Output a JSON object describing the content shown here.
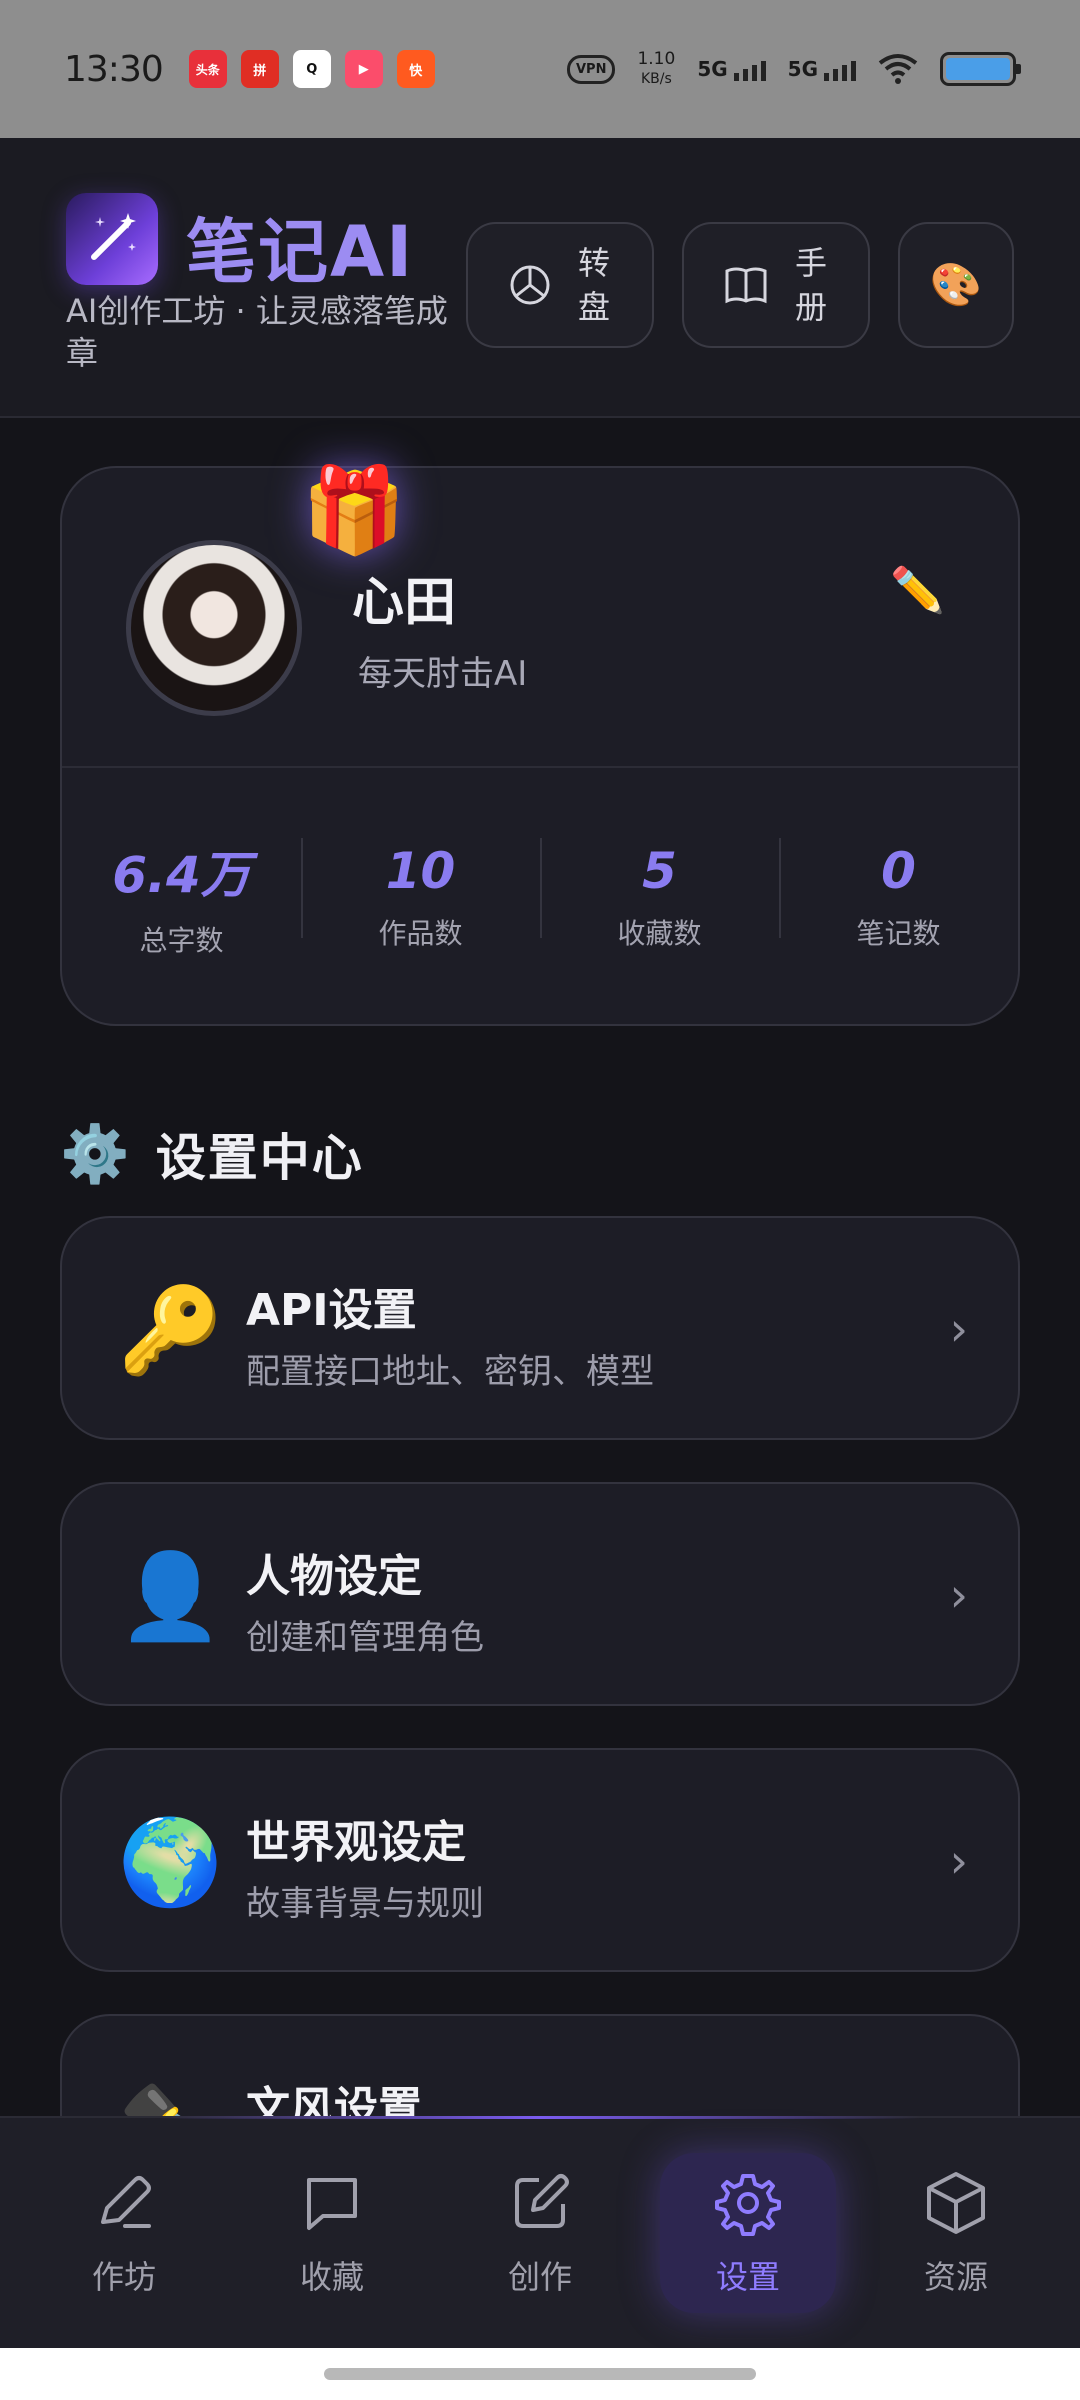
{
  "status_bar": {
    "time": "13:30",
    "apps": [
      {
        "name": "头条",
        "color": "#e8303a"
      },
      {
        "name": "拼",
        "color": "#e02e24"
      },
      {
        "name": "Q",
        "color": "#ffffff"
      },
      {
        "name": "▶",
        "color": "#fb4d6b"
      },
      {
        "name": "快",
        "color": "#ff5a1f"
      }
    ],
    "vpn": "VPN",
    "speed_value": "1.10",
    "speed_unit": "KB/s",
    "net1": "5G",
    "net2": "5G"
  },
  "header": {
    "app_title": "笔记AI",
    "subtitle": "AI创作工坊 · 让灵感落笔成章",
    "wheel_label": "转盘",
    "manual_label": "手册"
  },
  "profile": {
    "name": "心田",
    "bio": "每天肘击AI",
    "stats": [
      {
        "value": "6.4万",
        "label": "总字数"
      },
      {
        "value": "10",
        "label": "作品数"
      },
      {
        "value": "5",
        "label": "收藏数"
      },
      {
        "value": "0",
        "label": "笔记数"
      }
    ]
  },
  "settings": {
    "section_title": "设置中心",
    "items": [
      {
        "icon": "🔑",
        "title": "API设置",
        "subtitle": "配置接口地址、密钥、模型"
      },
      {
        "icon": "👤",
        "title": "人物设定",
        "subtitle": "创建和管理角色"
      },
      {
        "icon": "🌍",
        "title": "世界观设定",
        "subtitle": "故事背景与规则"
      },
      {
        "icon": "✒️",
        "title": "文风设置",
        "subtitle": ""
      }
    ]
  },
  "nav": {
    "items": [
      {
        "label": "作坊"
      },
      {
        "label": "收藏"
      },
      {
        "label": "创作"
      },
      {
        "label": "设置"
      },
      {
        "label": "资源"
      }
    ]
  },
  "colors": {
    "accent": "#8f7cff",
    "background": "#141419",
    "card": "#1d1d26"
  }
}
